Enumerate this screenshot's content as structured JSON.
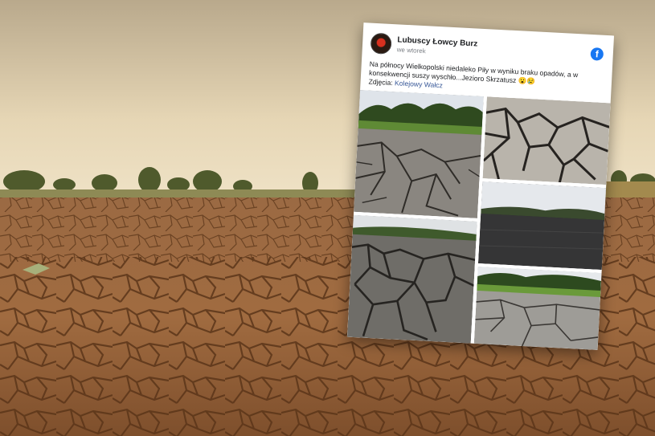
{
  "post": {
    "page_name": "Lubuscy Łowcy Burz",
    "time": "we wtorek",
    "text": "Na północy Wielkopolski niedaleko Piły w wyniku braku opadów, a w konsekwencji suszy wyschło...Jezioro Skrzatusz 😮😢",
    "credit_prefix": "Zdjęcia: ",
    "credit_link": "Kolejowy Wałcz"
  },
  "icons": {
    "social": "facebook-icon",
    "avatar": "page-avatar"
  },
  "colors": {
    "facebook_blue": "#1877f2",
    "link_blue": "#385898",
    "soil": "#8a5a33",
    "sky": "#d9c7a4"
  }
}
